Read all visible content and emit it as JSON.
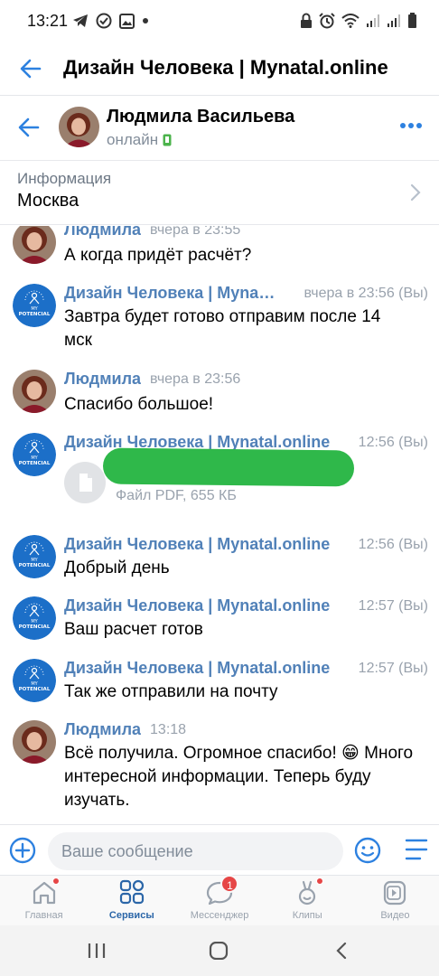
{
  "status_bar": {
    "time": "13:21",
    "left_icons": [
      "telegram-icon",
      "check-circle-icon",
      "gallery-icon",
      "dot-icon"
    ],
    "right_icons": [
      "lock-icon",
      "alarm-icon",
      "wifi-icon",
      "signal-icon",
      "signal-icon",
      "battery-icon"
    ]
  },
  "app_bar": {
    "title": "Дизайн Человека | Mynatal.online",
    "back_icon": "arrow-left-icon"
  },
  "chat_header": {
    "name": "Людмила Васильева",
    "status": "онлайн",
    "more_icon": "more-dots-icon"
  },
  "info_bar": {
    "label": "Информация",
    "value": "Москва"
  },
  "messages": [
    {
      "sender": "Людмила",
      "time": "вчера в 23:55",
      "kind": "user",
      "text": "А когда придёт расчёт?"
    },
    {
      "sender": "Дизайн Человека | Mynatal.online",
      "time": "вчера в 23:56",
      "suffix": "(Вы)",
      "kind": "group",
      "text": "Завтра будет готово отправим после 14 мск"
    },
    {
      "sender": "Людмила",
      "time": "вчера в 23:56",
      "kind": "user",
      "text": "Спасибо большое!"
    },
    {
      "sender": "Дизайн Человека | Mynatal.online",
      "time": "12:56",
      "suffix": "(Вы)",
      "kind": "group",
      "file_meta": "Файл PDF, 655 КБ"
    },
    {
      "sender": "Дизайн Человека | Mynatal.online",
      "time": "12:56",
      "suffix": "(Вы)",
      "kind": "group",
      "text": "Добрый день"
    },
    {
      "sender": "Дизайн Человека | Mynatal.online",
      "time": "12:57",
      "suffix": "(Вы)",
      "kind": "group",
      "text": "Ваш расчет готов"
    },
    {
      "sender": "Дизайн Человека | Mynatal.online",
      "time": "12:57",
      "suffix": "(Вы)",
      "kind": "group",
      "text": "Так же отправили на почту"
    },
    {
      "sender": "Людмила",
      "time": "13:18",
      "kind": "user",
      "text": "Всё получила. Огромное спасибо! 😁 Много интересной информации. Теперь буду изучать."
    }
  ],
  "group_avatar_text": [
    "MY",
    "POTENCIAL"
  ],
  "composer": {
    "placeholder": "Ваше сообщение"
  },
  "tabs": [
    {
      "label": "Главная",
      "icon": "home-icon",
      "dot": true
    },
    {
      "label": "Сервисы",
      "icon": "services-grid-icon",
      "active": true
    },
    {
      "label": "Мессенджер",
      "icon": "messenger-icon",
      "badge": "1"
    },
    {
      "label": "Клипы",
      "icon": "clips-icon",
      "dot": true
    },
    {
      "label": "Видео",
      "icon": "video-icon"
    }
  ],
  "colors": {
    "accent": "#5181b8",
    "active_tab": "#2b66a8",
    "online": "#4bb34b",
    "badge": "#e64646",
    "group_avatar": "#1c6fc8"
  }
}
